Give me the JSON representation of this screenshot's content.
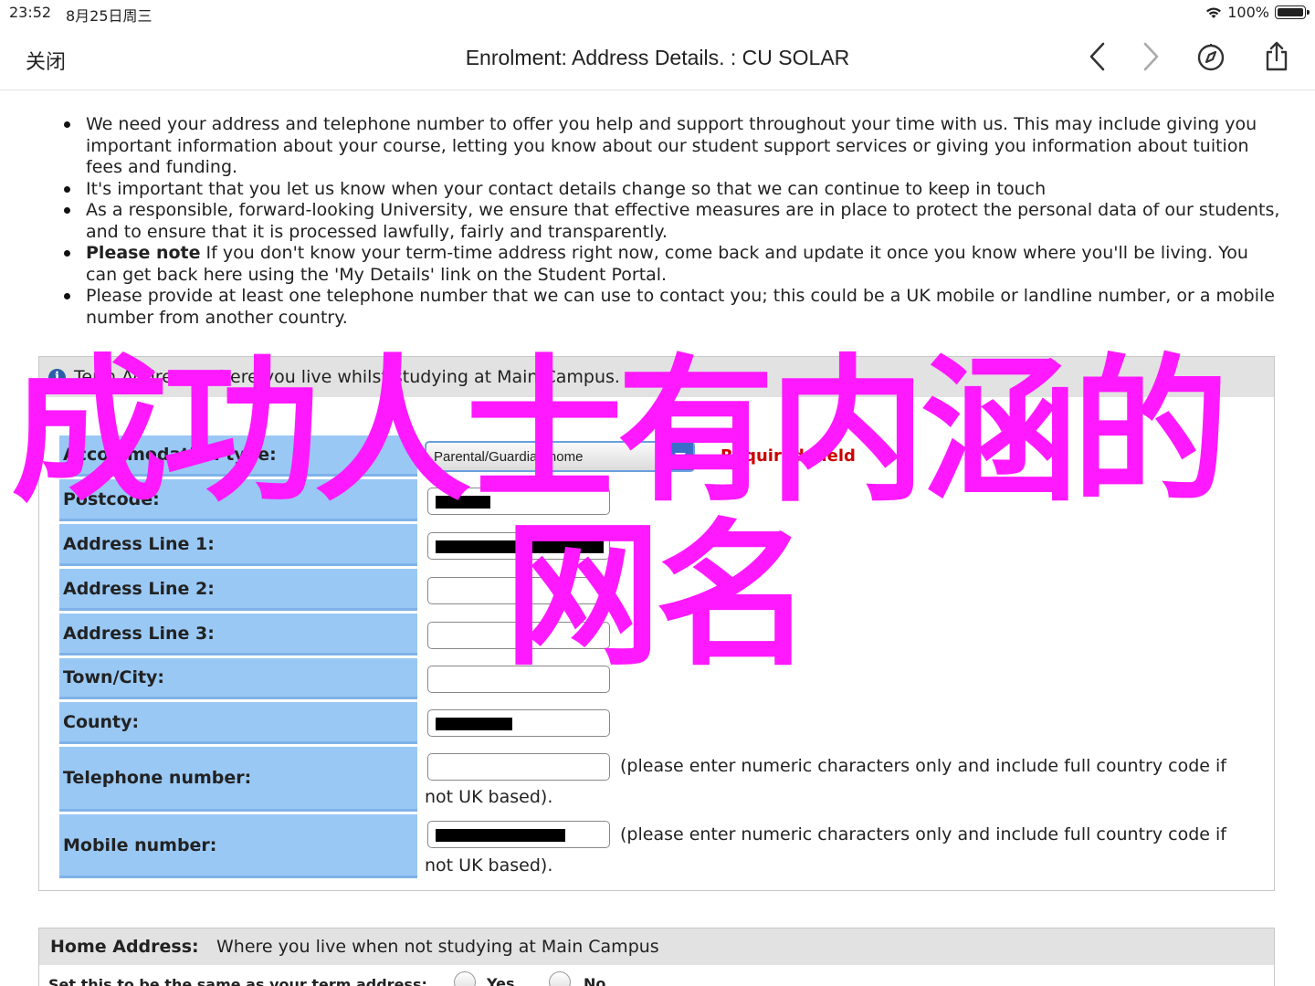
{
  "status_bar": {
    "time": "23:52",
    "date": "8月25日周三",
    "battery": "100%"
  },
  "nav": {
    "close_label": "关闭",
    "title": "Enrolment: Address Details. : CU SOLAR"
  },
  "intro_bullets": [
    "We need your address and telephone number to offer you help and support throughout your time with us. This may include giving you important information about your course, letting you know about our student support services or giving you information about tuition fees and funding.",
    "It's important that you let us know when your contact details change so that we can continue to keep in touch",
    "As a responsible, forward-looking University, we ensure that effective measures are in place to protect the personal data of our students, and to ensure that it is processed lawfully, fairly and transparently.",
    {
      "bold": "Please note",
      "text": " If you don't know your term-time address right now, come back and update it once you know where you'll be living. You can get back here using the 'My Details' link on the Student Portal."
    },
    "Please provide at least one telephone number that we can use to contact you; this could be a UK mobile or landline number, or a mobile number from another country."
  ],
  "term_address": {
    "heading_text": "Term Address: Where you live whilst studying at Main Campus.",
    "accommodation_label": "Accommodation type:",
    "accommodation_value": "Parental/Guardian home",
    "required_text": "Required Field",
    "postcode_label": "Postcode:",
    "address1_label": "Address Line 1:",
    "address2_label": "Address Line 2:",
    "address3_label": "Address Line 3:",
    "town_label": "Town/City:",
    "county_label": "County:",
    "telephone_label": "Telephone number:",
    "mobile_label": "Mobile number:",
    "phone_hint_line1": "(please enter numeric characters only and include full country code if",
    "phone_hint_line2": "not UK based)."
  },
  "home_address": {
    "title": "Home Address:",
    "subtitle": "Where you live when not studying at Main Campus",
    "same_as_term_label": "Set this to be the same as your term address:",
    "yes_label": "Yes",
    "no_label": "No"
  },
  "watermark": {
    "line1": "成功人士有内涵的",
    "line2": "网名",
    "color": "#ff19ff"
  },
  "colors": {
    "label_bg": "#99c8f5",
    "panel_head": "#e2e2e2",
    "required": "#cc0000",
    "select_accent": "#3a6fc9"
  }
}
